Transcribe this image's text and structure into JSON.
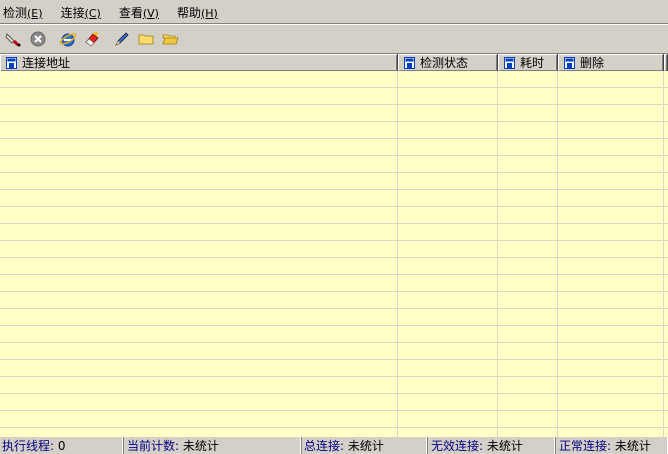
{
  "menu": {
    "items": [
      {
        "label": "检测",
        "accel": "(E)"
      },
      {
        "label": "连接",
        "accel": "(C)"
      },
      {
        "label": "查看",
        "accel": "(V)"
      },
      {
        "label": "帮助",
        "accel": "(H)"
      }
    ]
  },
  "toolbar": {
    "buttons": [
      "clear-icon",
      "stop-icon",
      "ie-icon",
      "eraser-icon",
      "pen-icon",
      "folder-icon",
      "open-folder-icon"
    ]
  },
  "list": {
    "columns": [
      "连接地址",
      "检测状态",
      "耗时",
      "删除"
    ],
    "row_count": 0
  },
  "status": {
    "threads_label": "执行线程:",
    "threads_value": "0",
    "count_label": "当前计数:",
    "count_value": "未统计",
    "total_label": "总连接:",
    "total_value": "未统计",
    "invalid_label": "无效连接:",
    "invalid_value": "未统计",
    "normal_label": "正常连接:",
    "normal_value": "未统计"
  },
  "colors": {
    "list_background": "#ffffc6",
    "chrome": "#d4d0c8",
    "status_label": "#000080"
  }
}
